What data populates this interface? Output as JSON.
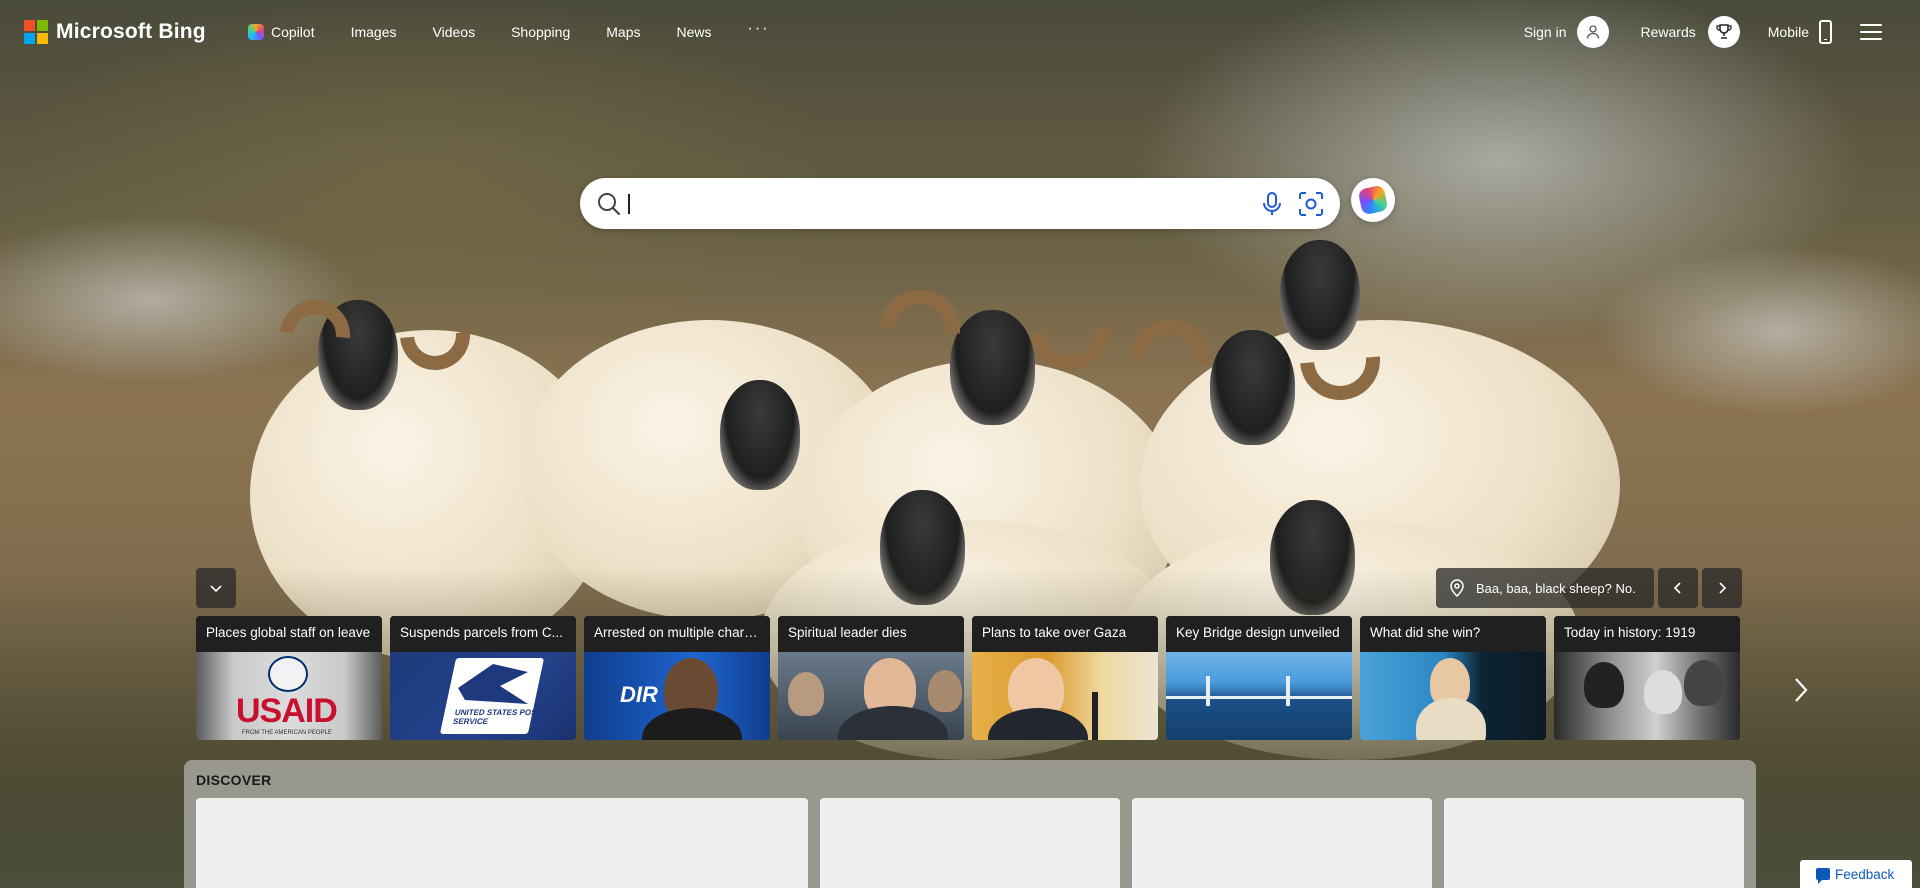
{
  "brand": {
    "name": "Microsoft Bing"
  },
  "nav": {
    "items": [
      {
        "label": "Copilot",
        "icon": "copilot-icon"
      },
      {
        "label": "Images"
      },
      {
        "label": "Videos"
      },
      {
        "label": "Shopping"
      },
      {
        "label": "Maps"
      },
      {
        "label": "News"
      }
    ],
    "more_label": "···"
  },
  "account": {
    "sign_in_label": "Sign in",
    "rewards_label": "Rewards",
    "mobile_label": "Mobile"
  },
  "search": {
    "value": "",
    "placeholder": ""
  },
  "image_info": {
    "label": "Baa, baa, black sheep? No."
  },
  "news": [
    {
      "title": "Places global staff on leave",
      "image": "usaid-logo"
    },
    {
      "title": "Suspends parcels from C...",
      "image": "usps-logo"
    },
    {
      "title": "Arrested on multiple charges",
      "image": "person-photo"
    },
    {
      "title": "Spiritual leader dies",
      "image": "crowd-photo"
    },
    {
      "title": "Plans to take over Gaza",
      "image": "podium-photo"
    },
    {
      "title": "Key Bridge design unveiled",
      "image": "bridge-rendering"
    },
    {
      "title": "What did she win?",
      "image": "stage-photo"
    },
    {
      "title": "Today in history: 1919",
      "image": "vintage-photo"
    }
  ],
  "news_images": {
    "usaid_word": "USAID",
    "usaid_sub": "FROM THE AMERICAN PEOPLE",
    "usps_text": "UNITED STATES POSTAL SERVICE",
    "dir_text": "DIR"
  },
  "discover": {
    "title": "DISCOVER"
  },
  "feedback": {
    "label": "Feedback"
  },
  "colors": {
    "ms_red": "#f25022",
    "ms_green": "#7fba00",
    "ms_blue": "#00a4ef",
    "ms_yellow": "#ffb900",
    "feedback_blue": "#0c5ab5"
  }
}
